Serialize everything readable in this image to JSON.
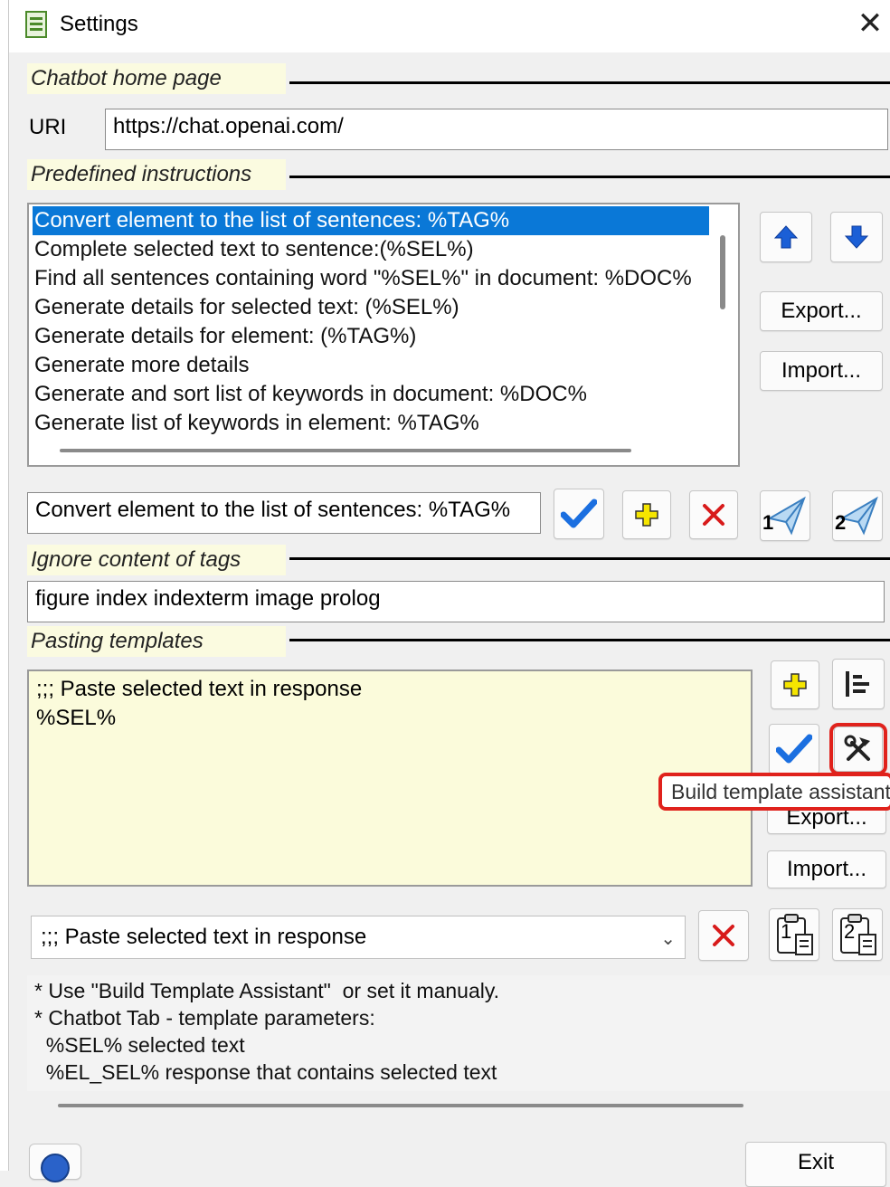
{
  "window": {
    "title": "Settings",
    "close_symbol": "✕"
  },
  "chatbot_home": {
    "section_label": "Chatbot home page",
    "uri_label": "URI",
    "uri_value": "https://chat.openai.com/"
  },
  "instructions": {
    "section_label": "Predefined instructions",
    "items": [
      "Convert element to the list of sentences: %TAG%",
      "Complete selected text to sentence:(%SEL%)",
      "Find all sentences containing word \"%SEL%\" in document: %DOC%",
      "Generate details for selected text: (%SEL%)",
      "Generate details for element: (%TAG%)",
      "Generate more details",
      "Generate and sort list of keywords in document: %DOC%",
      "Generate list of keywords in element: %TAG%"
    ],
    "selected_index": 0,
    "export_label": "Export...",
    "import_label": "Import...",
    "edit_value": "Convert element to the list of sentences: %TAG%",
    "send1_number": "1",
    "send2_number": "2"
  },
  "ignore_tags": {
    "section_label": "Ignore content of tags",
    "value": "figure index indexterm image prolog"
  },
  "templates": {
    "section_label": "Pasting templates",
    "memo_text": ";;; Paste selected text in response\n%SEL%",
    "tooltip": "Build template assistant",
    "export_label": "Export...",
    "import_label": "Import...",
    "combo_value": ";;; Paste selected text in response",
    "paste1_number": "1",
    "paste2_number": "2"
  },
  "notes": {
    "text": "* Use \"Build Template Assistant\"  or set it manualy.\n* Chatbot Tab - template parameters:\n  %SEL% selected text\n  %EL_SEL% response that contains selected text"
  },
  "footer": {
    "help_symbol": "?",
    "exit_label": "Exit"
  },
  "colors": {
    "selection": "#0a78d7",
    "memo_bg": "#fbfbdb",
    "section_bg": "#fbfbe0",
    "highlight": "#e0221c",
    "icon_blue": "#1b5fd6"
  }
}
